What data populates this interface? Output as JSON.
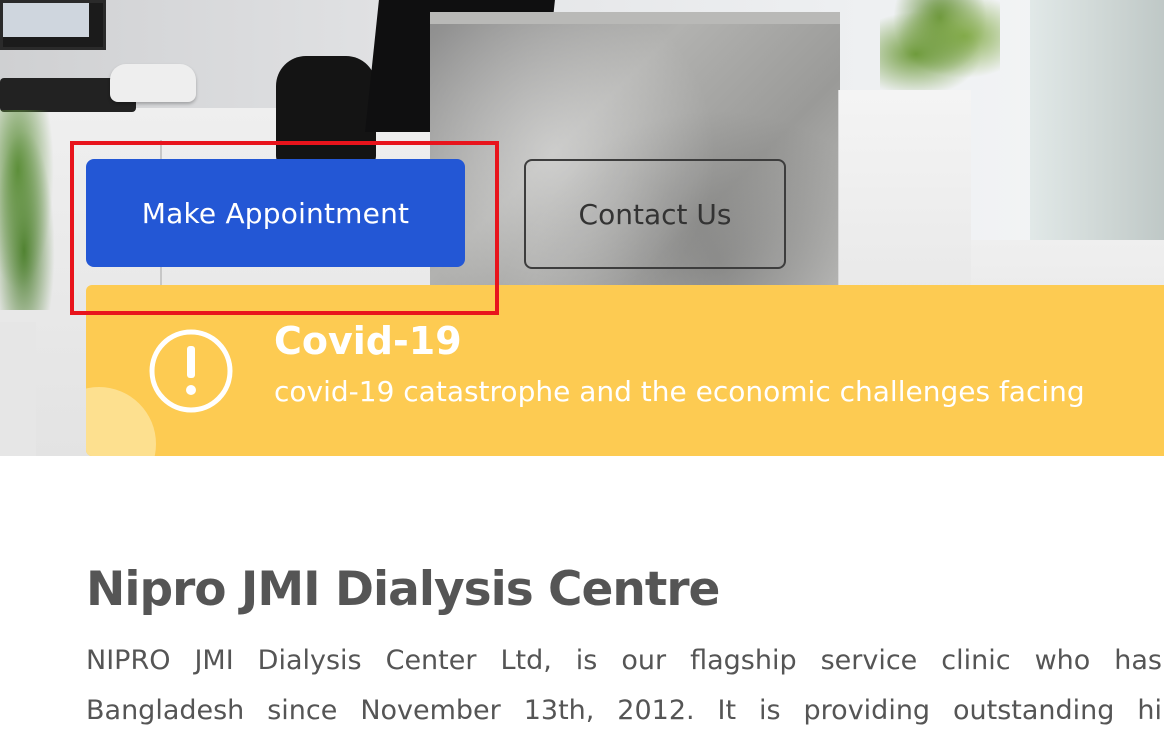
{
  "hero": {
    "primary_button_label": "Make Appointment",
    "secondary_button_label": "Contact Us"
  },
  "covid": {
    "icon": "exclamation-circle-icon",
    "title": "Covid-19",
    "text": "covid-19 catastrophe and the economic challenges facing"
  },
  "about": {
    "title": "Nipro JMI Dialysis Centre",
    "paragraph_lines": [
      "NIPRO JMI Dialysis Center Ltd, is our flagship service clinic who has",
      "Bangladesh since November 13th, 2012. It is providing outstanding hi"
    ]
  },
  "colors": {
    "primary": "#2357d5",
    "banner": "#fdcb52",
    "highlight": "#e8141c",
    "text": "#555555"
  }
}
